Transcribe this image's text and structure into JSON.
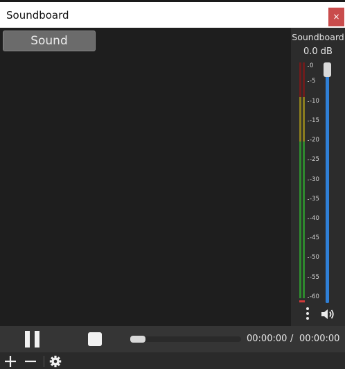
{
  "window": {
    "title": "Soundboard",
    "close_label": "×"
  },
  "main": {
    "sound_button_label": "Sound"
  },
  "mixer": {
    "source_name": "Soundboard",
    "volume_db": "0.0 dB",
    "ticks": [
      "0",
      "-5",
      "-10",
      "-15",
      "-20",
      "-25",
      "-30",
      "-35",
      "-40",
      "-45",
      "-50",
      "-55",
      "-60"
    ],
    "volume_level": 1.0,
    "colors": {
      "meter_red": "#8a1f1f",
      "meter_yellow": "#9a8a1f",
      "meter_green": "#2f8a2f",
      "fader": "#2f7fd6"
    }
  },
  "controls": {
    "current_time": "00:00:00",
    "separator": "/",
    "total_time": "00:00:00",
    "progress": 0.0
  },
  "toolbar": {
    "icons": [
      "plus-icon",
      "minus-icon",
      "gear-icon"
    ]
  }
}
